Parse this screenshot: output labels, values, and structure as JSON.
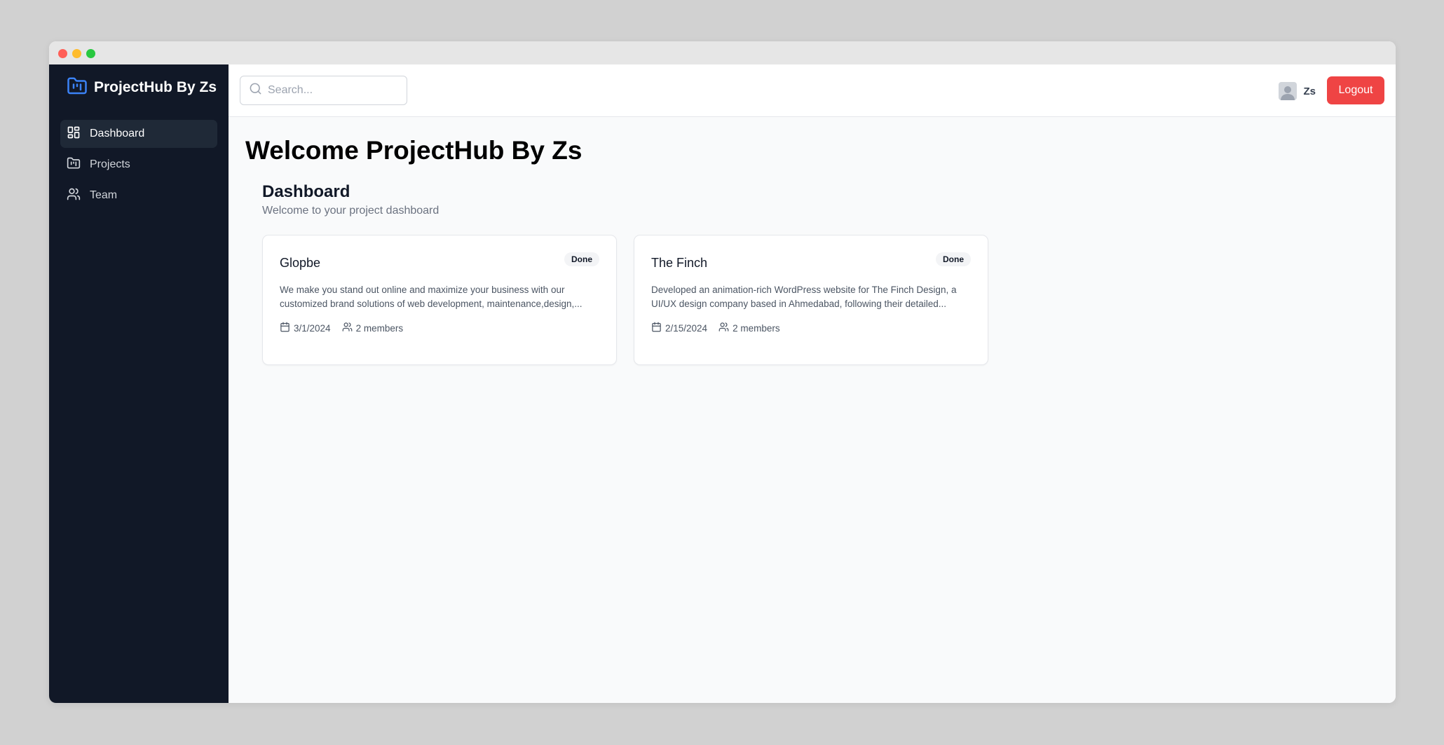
{
  "brand": {
    "name": "ProjectHub By Zs",
    "accent": "#3b82f6"
  },
  "sidebar": {
    "items": [
      {
        "label": "Dashboard",
        "icon": "dashboard-icon",
        "active": true
      },
      {
        "label": "Projects",
        "icon": "folder-icon",
        "active": false
      },
      {
        "label": "Team",
        "icon": "users-icon",
        "active": false
      }
    ]
  },
  "topbar": {
    "search_placeholder": "Search...",
    "user_name": "Zs",
    "logout_label": "Logout"
  },
  "main": {
    "welcome": "Welcome ProjectHub By Zs",
    "section_title": "Dashboard",
    "section_subtitle": "Welcome to your project dashboard",
    "projects": [
      {
        "title": "Glopbe",
        "status": "Done",
        "description": "We make you stand out online and maximize your business with our customized brand solutions of web development, maintenance,design,...",
        "date": "3/1/2024",
        "members": "2 members"
      },
      {
        "title": "The Finch",
        "status": "Done",
        "description": "Developed an animation-rich WordPress website for The Finch Design, a UI/UX design company based in Ahmedabad, following their detailed...",
        "date": "2/15/2024",
        "members": "2 members"
      }
    ]
  },
  "colors": {
    "sidebar_bg": "#111827",
    "logout_bg": "#ef4444",
    "main_bg": "#f9fafb"
  }
}
